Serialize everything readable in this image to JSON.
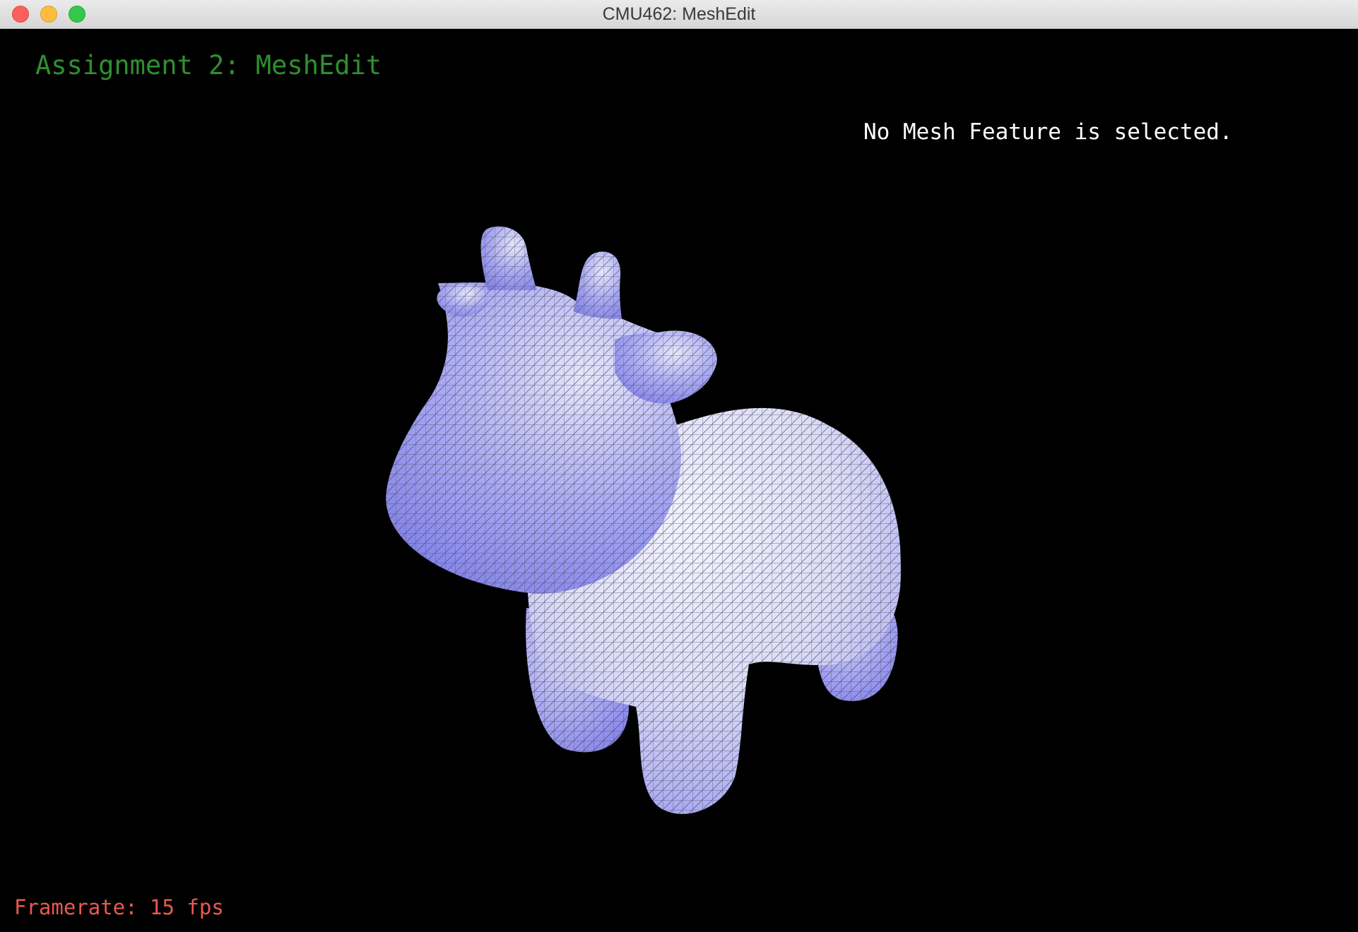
{
  "window": {
    "title": "CMU462: MeshEdit"
  },
  "hud": {
    "title": "Assignment 2: MeshEdit",
    "status": "No Mesh Feature is selected.",
    "framerate": "Framerate: 15 fps"
  },
  "colors": {
    "mesh_fill": "#8f8ff5",
    "mesh_highlight": "#f0f0ff",
    "wireframe": "#555566",
    "title_green": "#2f8f2f",
    "fps_red": "#e85a4f"
  }
}
